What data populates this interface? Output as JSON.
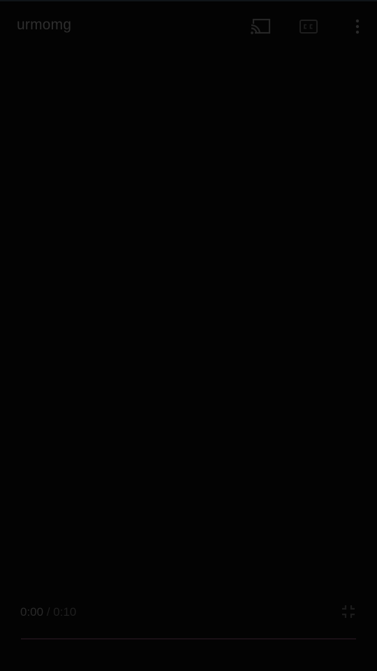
{
  "header": {
    "title": "urmomg",
    "icons": {
      "cast": "cast-icon",
      "captions": "closed-captions-icon",
      "more": "more-vert-icon"
    }
  },
  "controls": {
    "current_time": "0:00",
    "separator": "/",
    "duration": "0:10",
    "fullscreen_icon": "exit-fullscreen-icon",
    "progress_fraction": 0.0
  },
  "colors": {
    "background": "#030303",
    "progress_played": "#3a0c14",
    "progress_track": "#1a1016"
  }
}
